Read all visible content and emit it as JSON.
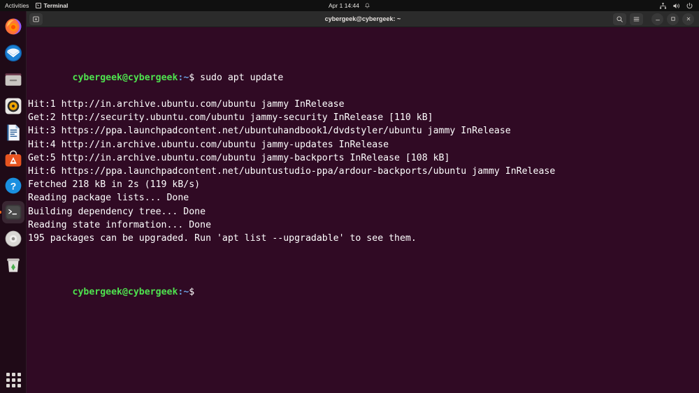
{
  "topbar": {
    "activities": "Activities",
    "app_name": "Terminal",
    "app_icon": "terminal-icon",
    "clock": "Apr 1  14:44",
    "notification_icon": "bell-icon",
    "tray": [
      {
        "name": "network-icon",
        "label": "Network"
      },
      {
        "name": "volume-icon",
        "label": "Volume"
      },
      {
        "name": "power-icon",
        "label": "Power"
      }
    ]
  },
  "dock": {
    "items": [
      {
        "name": "dock-item-firefox",
        "label": "Firefox",
        "running": false
      },
      {
        "name": "dock-item-thunderbird",
        "label": "Thunderbird Mail",
        "running": false
      },
      {
        "name": "dock-item-files",
        "label": "Files",
        "running": false
      },
      {
        "name": "dock-item-rhythmbox",
        "label": "Rhythmbox",
        "running": false
      },
      {
        "name": "dock-item-libreoffice-writer",
        "label": "LibreOffice Writer",
        "running": false
      },
      {
        "name": "dock-item-ubuntu-software",
        "label": "Ubuntu Software",
        "running": false
      },
      {
        "name": "dock-item-help",
        "label": "Help",
        "running": false
      },
      {
        "name": "dock-item-terminal",
        "label": "Terminal",
        "running": true
      },
      {
        "name": "dock-item-disk-image",
        "label": "Disk Image Writer",
        "running": false
      },
      {
        "name": "dock-item-trash",
        "label": "Trash",
        "running": false
      }
    ],
    "show_apps_label": "Show Applications"
  },
  "window": {
    "title": "cybergeek@cybergeek: ~",
    "new_tab_label": "New Tab",
    "search_label": "Search",
    "menu_label": "Main Menu",
    "minimize_label": "Minimize",
    "maximize_label": "Maximize",
    "close_label": "Close"
  },
  "terminal": {
    "prompt_user": "cybergeek@cybergeek",
    "prompt_path": ":~",
    "prompt_symbol": "$ ",
    "command": "sudo apt update",
    "output": [
      "Hit:1 http://in.archive.ubuntu.com/ubuntu jammy InRelease",
      "Get:2 http://security.ubuntu.com/ubuntu jammy-security InRelease [110 kB]",
      "Hit:3 https://ppa.launchpadcontent.net/ubuntuhandbook1/dvdstyler/ubuntu jammy InRelease",
      "Hit:4 http://in.archive.ubuntu.com/ubuntu jammy-updates InRelease",
      "Get:5 http://in.archive.ubuntu.com/ubuntu jammy-backports InRelease [108 kB]",
      "Hit:6 https://ppa.launchpadcontent.net/ubuntustudio-ppa/ardour-backports/ubuntu jammy InRelease",
      "Fetched 218 kB in 2s (119 kB/s)",
      "Reading package lists... Done",
      "Building dependency tree... Done",
      "Reading state information... Done",
      "195 packages can be upgraded. Run 'apt list --upgradable' to see them."
    ]
  },
  "colors": {
    "terminal_background": "#300a24",
    "prompt_green": "#4ee24e",
    "prompt_blue": "#6a9fe0",
    "accent_orange": "#e8641c",
    "topbar_background": "#101010",
    "titlebar_background": "#2b2b2b"
  }
}
